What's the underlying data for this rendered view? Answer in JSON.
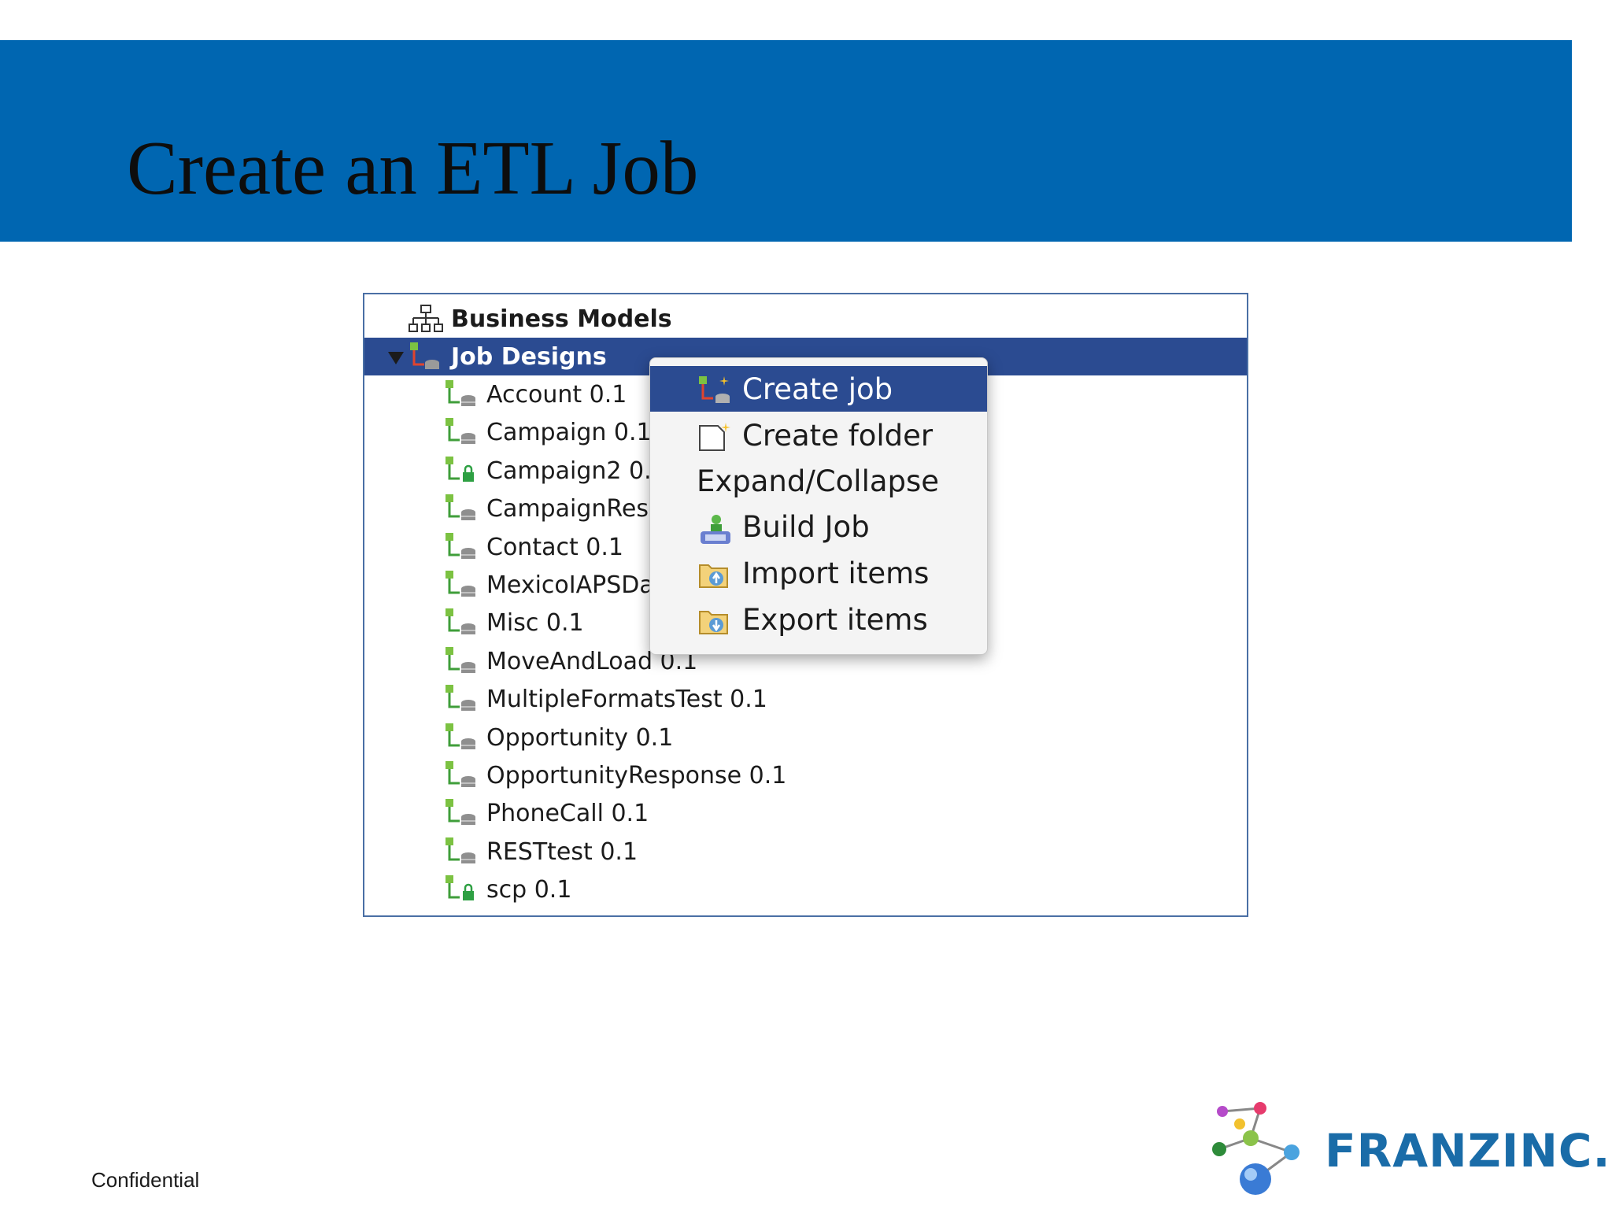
{
  "slide": {
    "title": "Create an ETL Job",
    "footer": "Confidential"
  },
  "tree": {
    "business_models": "Business Models",
    "job_designs": "Job Designs",
    "jobs": [
      {
        "label": "Account 0.1",
        "locked": false
      },
      {
        "label": "Campaign 0.1",
        "locked": false
      },
      {
        "label": "Campaign2 0.",
        "locked": true
      },
      {
        "label": "CampaignRes",
        "locked": false
      },
      {
        "label": "Contact 0.1",
        "locked": false
      },
      {
        "label": "MexicoIAPSDa",
        "locked": false
      },
      {
        "label": "Misc 0.1",
        "locked": false
      },
      {
        "label": "MoveAndLoad 0.1",
        "locked": false
      },
      {
        "label": "MultipleFormatsTest 0.1",
        "locked": false
      },
      {
        "label": "Opportunity 0.1",
        "locked": false
      },
      {
        "label": "OpportunityResponse 0.1",
        "locked": false
      },
      {
        "label": "PhoneCall 0.1",
        "locked": false
      },
      {
        "label": "RESTtest 0.1",
        "locked": false
      },
      {
        "label": "scp 0.1",
        "locked": true
      }
    ]
  },
  "context_menu": {
    "items": [
      {
        "label": "Create job",
        "icon": "create-job-icon"
      },
      {
        "label": "Create folder",
        "icon": "create-folder-icon"
      },
      {
        "label": "Expand/Collapse",
        "icon": ""
      },
      {
        "label": "Build Job",
        "icon": "build-job-icon"
      },
      {
        "label": "Import items",
        "icon": "import-items-icon"
      },
      {
        "label": "Export items",
        "icon": "export-items-icon"
      }
    ]
  },
  "logo": {
    "text": "FRANZINC."
  },
  "colors": {
    "banner": "#0066b1",
    "selection": "#2b4b91",
    "logo_text": "#1a6ca8"
  }
}
